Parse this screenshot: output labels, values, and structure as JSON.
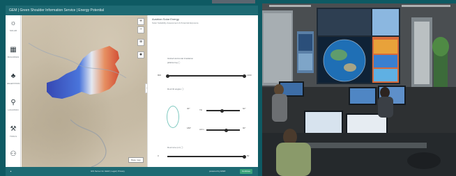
{
  "app": {
    "header_title": "GEM | Green Shoulder Information Service | Energy Potential",
    "sidebar": [
      {
        "icon": "solar-icon",
        "glyph": "☼",
        "label": "SOLAR"
      },
      {
        "icon": "buildings-icon",
        "glyph": "▦",
        "label": "BUILDINGS"
      },
      {
        "icon": "tree-icon",
        "glyph": "♣",
        "label": "VEGETATION"
      },
      {
        "icon": "location-icon",
        "glyph": "⚲",
        "label": "LOCATION"
      },
      {
        "icon": "tools-icon",
        "glyph": "⚒",
        "label": "TOOLS"
      },
      {
        "icon": "user-icon",
        "glyph": "⚇",
        "label": ""
      }
    ],
    "map_controls": {
      "zoom_in": "+",
      "zoom_out": "−",
      "layers": "≡",
      "locate": "●"
    },
    "map_chip": "Base map",
    "panel": {
      "title": "Austrian Solar Energy",
      "subtitle": "Solar Suitability Assessment & Potential Exposure",
      "section1_label": "Global Horizontal Irradiation",
      "section1_unit": "[kWh/m²/a] ⓘ",
      "range_min": "800",
      "range_max": "1400",
      "section2_label": "Roof tilt angles ⓘ",
      "tilt_a": "30°",
      "tilt_b": "60°",
      "azimuth_a": "180°",
      "azimuth_b": "90°",
      "tilt_label": "Tilt",
      "azimuth_label": "Azim",
      "section3_label": "Roof size (m²) ⓘ",
      "size_min": "0",
      "size_max": "50"
    },
    "collapse_glyph": "›",
    "footer_left": "▲",
    "footer_center": "GIS Server for GEM  |  Legal | Privacy",
    "footer_right": "powered by ESRI",
    "footer_button": "Continue"
  },
  "photo": {
    "scene": "control room"
  },
  "colors": {
    "frame": "#0e5a63",
    "header": "#1e6a73",
    "map_base": "#c9bda8",
    "heat_low": "#1f3fbf",
    "heat_mid": "#ffffff",
    "heat_high": "#e05a2a"
  }
}
